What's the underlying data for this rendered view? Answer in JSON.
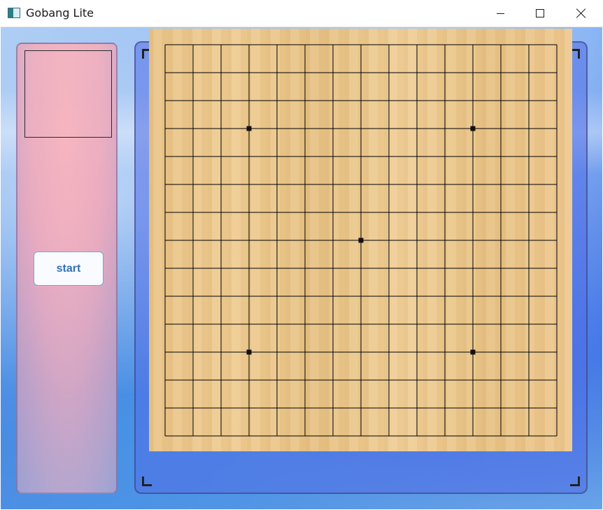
{
  "window": {
    "title": "Gobang Lite",
    "controls": [
      "minimize",
      "maximize",
      "close"
    ]
  },
  "sidebar": {
    "start_label": "start"
  },
  "board": {
    "size": 15,
    "star_points": [
      [
        3,
        3
      ],
      [
        11,
        3
      ],
      [
        7,
        7
      ],
      [
        3,
        11
      ],
      [
        11,
        11
      ]
    ],
    "line_color": "#000000",
    "wood_color": "#ecc78d"
  },
  "colors": {
    "accent": "#2e6fb2",
    "panel": "#eeb3c0",
    "frame": "#5a74e0"
  }
}
